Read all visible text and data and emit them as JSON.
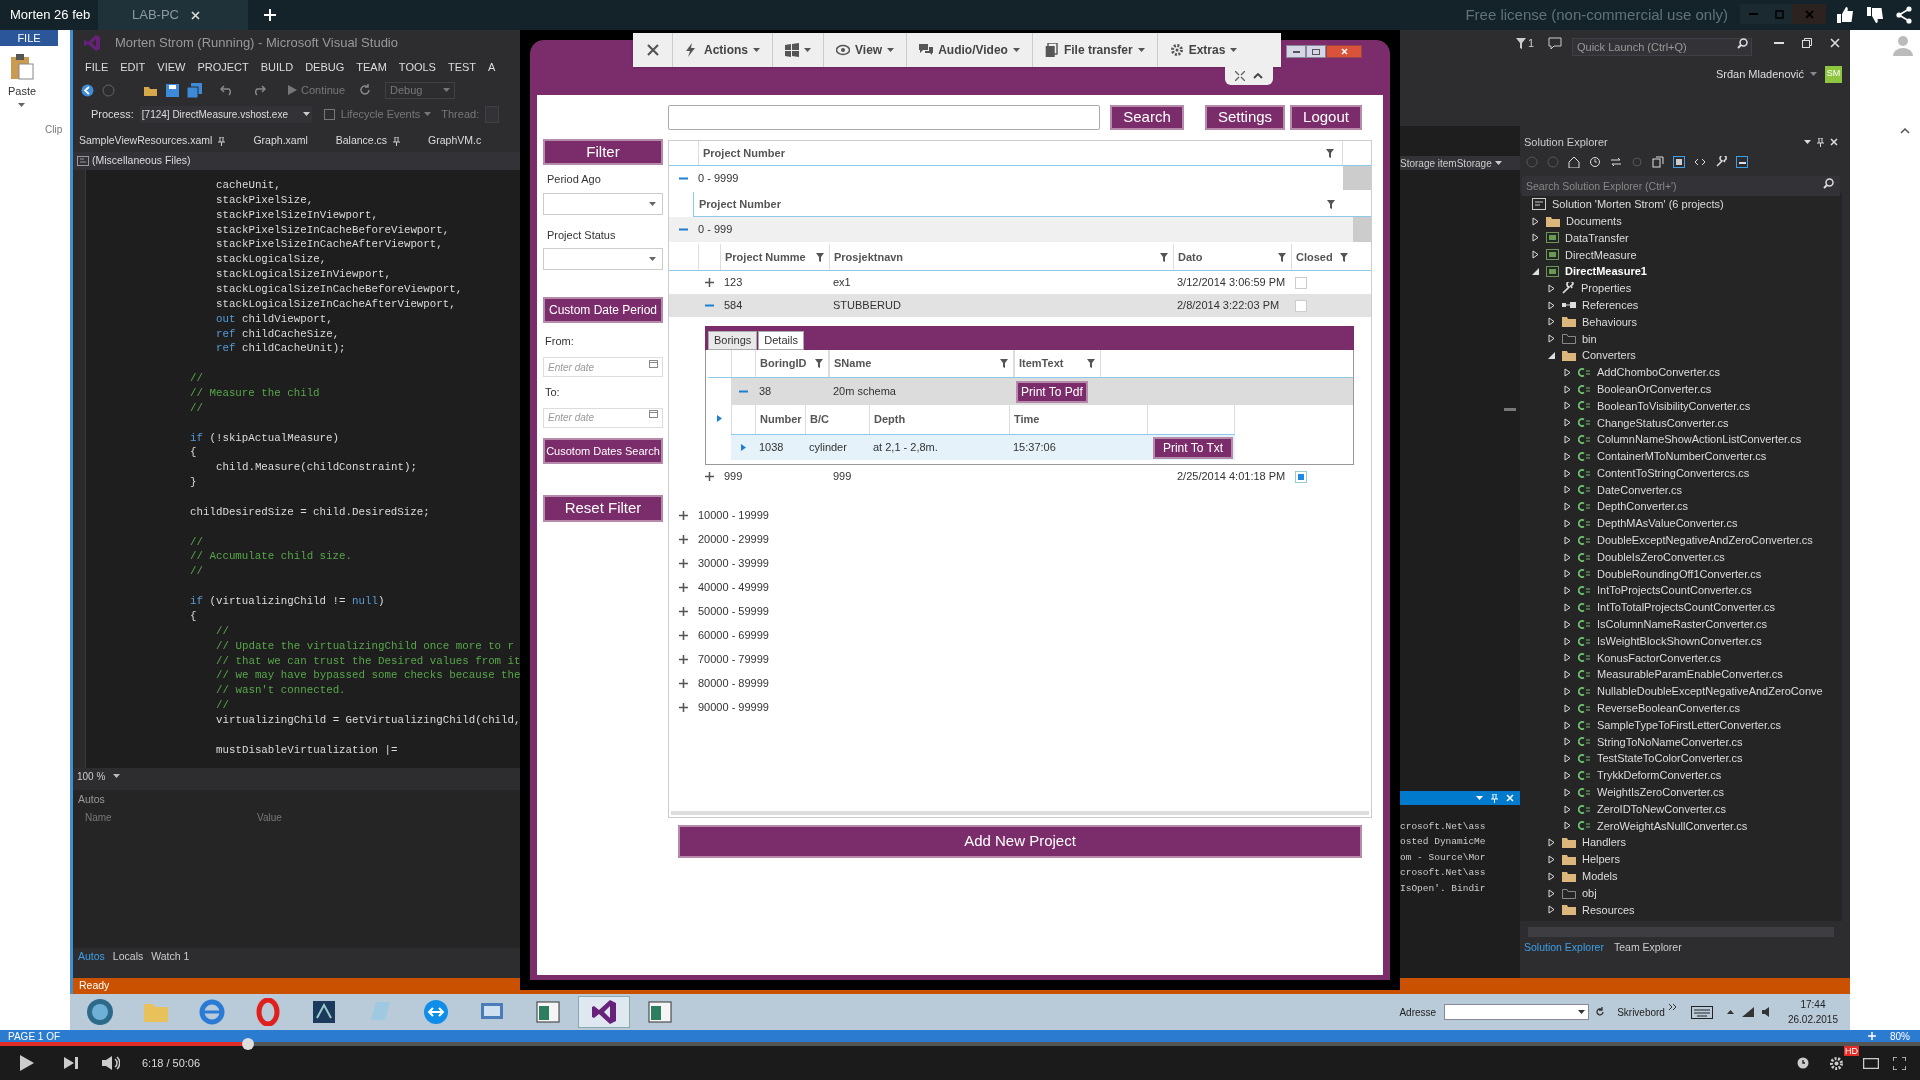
{
  "video_title": "Morten 26 feb",
  "remote_tabs": [
    {
      "label": "LAB-PC",
      "selected": true
    }
  ],
  "license_notice": "Free license (non-commercial use only)",
  "word": {
    "file_tab": "FILE",
    "paste_label": "Paste",
    "group_label": "Clip",
    "page_status": "PAGE 1 OF",
    "zoom": "80%"
  },
  "vs": {
    "title": "Morten Strom (Running) - Microsoft Visual Studio",
    "menu": [
      "FILE",
      "EDIT",
      "VIEW",
      "PROJECT",
      "BUILD",
      "DEBUG",
      "TEAM",
      "TOOLS",
      "TEST",
      "A"
    ],
    "notifications": "1",
    "quick_launch": {
      "placeholder": "Quick Launch (Ctrl+Q)"
    },
    "user": {
      "name": "Srđan Mladenović",
      "initials": "SM"
    },
    "continue": "Continue",
    "config": "Debug",
    "process_label": "Process:",
    "process": "[7124] DirectMeasure.vshost.exe",
    "lifecycle": "Lifecycle Events",
    "thread_label": "Thread:",
    "doc_tabs": [
      {
        "label": "SampleViewResources.xaml",
        "pinned": true
      },
      {
        "label": "Graph.xaml",
        "pinned": false
      },
      {
        "label": "Balance.cs",
        "pinned": true
      },
      {
        "label": "GraphVM.c",
        "pinned": false
      }
    ],
    "nav_scope": "(Miscellaneous Files)",
    "code": [
      {
        "kind": "block",
        "children": [
          {
            "kind": "line",
            "segments": [
              {
                "kind": "plain",
                "text": "cacheUnit,"
              }
            ]
          },
          {
            "kind": "line",
            "segments": [
              {
                "kind": "plain",
                "text": "stackPixelSize,"
              }
            ]
          },
          {
            "kind": "line",
            "segments": [
              {
                "kind": "plain",
                "text": "stackPixelSizeInViewport,"
              }
            ]
          },
          {
            "kind": "line",
            "segments": [
              {
                "kind": "plain",
                "text": "stackPixelSizeInCacheBeforeViewport,"
              }
            ]
          },
          {
            "kind": "line",
            "segments": [
              {
                "kind": "plain",
                "text": "stackPixelSizeInCacheAfterViewport,"
              }
            ]
          },
          {
            "kind": "line",
            "segments": [
              {
                "kind": "plain",
                "text": "stackLogicalSize,"
              }
            ]
          },
          {
            "kind": "line",
            "segments": [
              {
                "kind": "plain",
                "text": "stackLogicalSizeInViewport,"
              }
            ]
          },
          {
            "kind": "line",
            "segments": [
              {
                "kind": "plain",
                "text": "stackLogicalSizeInCacheBeforeViewport,"
              }
            ]
          },
          {
            "kind": "line",
            "segments": [
              {
                "kind": "plain",
                "text": "stackLogicalSizeInCacheAfterViewport,"
              }
            ]
          },
          {
            "kind": "line",
            "segments": [
              {
                "kind": "keyword",
                "text": "out"
              },
              {
                "kind": "plain",
                "text": " childViewport,"
              }
            ]
          },
          {
            "kind": "line",
            "segments": [
              {
                "kind": "keyword",
                "text": "ref"
              },
              {
                "kind": "plain",
                "text": " childCacheSize,"
              }
            ]
          },
          {
            "kind": "line",
            "segments": [
              {
                "kind": "keyword",
                "text": "ref"
              },
              {
                "kind": "plain",
                "text": " childCacheUnit);"
              }
            ]
          }
        ]
      },
      {
        "kind": "blank"
      },
      {
        "kind": "line",
        "segments": [
          {
            "kind": "comment",
            "text": "//"
          }
        ]
      },
      {
        "kind": "line",
        "segments": [
          {
            "kind": "comment",
            "text": "// Measure the child"
          }
        ]
      },
      {
        "kind": "line",
        "segments": [
          {
            "kind": "comment",
            "text": "//"
          }
        ]
      },
      {
        "kind": "blank"
      },
      {
        "kind": "line",
        "segments": [
          {
            "kind": "keyword",
            "text": "if"
          },
          {
            "kind": "plain",
            "text": " (!skipActualMeasure)"
          }
        ]
      },
      {
        "kind": "line",
        "segments": [
          {
            "kind": "plain",
            "text": "{"
          }
        ]
      },
      {
        "kind": "block",
        "children": [
          {
            "kind": "line",
            "segments": [
              {
                "kind": "plain",
                "text": "child.Measure(childConstraint);"
              }
            ]
          }
        ]
      },
      {
        "kind": "line",
        "segments": [
          {
            "kind": "plain",
            "text": "}"
          }
        ]
      },
      {
        "kind": "blank"
      },
      {
        "kind": "line",
        "segments": [
          {
            "kind": "plain",
            "text": "childDesiredSize = child.DesiredSize;"
          }
        ]
      },
      {
        "kind": "blank"
      },
      {
        "kind": "line",
        "segments": [
          {
            "kind": "comment",
            "text": "//"
          }
        ]
      },
      {
        "kind": "line",
        "segments": [
          {
            "kind": "comment",
            "text": "// Accumulate child size."
          }
        ]
      },
      {
        "kind": "line",
        "segments": [
          {
            "kind": "comment",
            "text": "//"
          }
        ]
      },
      {
        "kind": "blank"
      },
      {
        "kind": "line",
        "segments": [
          {
            "kind": "keyword",
            "text": "if"
          },
          {
            "kind": "plain",
            "text": " (virtualizingChild != "
          },
          {
            "kind": "keyword",
            "text": "null"
          },
          {
            "kind": "plain",
            "text": ")"
          }
        ]
      },
      {
        "kind": "line",
        "segments": [
          {
            "kind": "plain",
            "text": "{"
          }
        ]
      },
      {
        "kind": "block",
        "children": [
          {
            "kind": "line",
            "segments": [
              {
                "kind": "comment",
                "text": "//"
              }
            ]
          },
          {
            "kind": "line",
            "segments": [
              {
                "kind": "comment",
                "text": "// Update the virtualizingChild once more to r"
              }
            ]
          },
          {
            "kind": "line",
            "segments": [
              {
                "kind": "comment",
                "text": "// that we can trust the Desired values from it"
              }
            ]
          },
          {
            "kind": "line",
            "segments": [
              {
                "kind": "comment",
                "text": "// we may have bypassed some checks because the"
              }
            ]
          },
          {
            "kind": "line",
            "segments": [
              {
                "kind": "comment",
                "text": "// wasn't connected."
              }
            ]
          },
          {
            "kind": "line",
            "segments": [
              {
                "kind": "comment",
                "text": "//"
              }
            ]
          },
          {
            "kind": "line",
            "segments": [
              {
                "kind": "plain",
                "text": "virtualizingChild = GetVirtualizingChild(child,"
              }
            ]
          },
          {
            "kind": "blank"
          },
          {
            "kind": "line",
            "segments": [
              {
                "kind": "plain",
                "text": "mustDisableVirtualization |="
              }
            ]
          }
        ]
      }
    ],
    "zoom": "100 %",
    "autos": {
      "title": "Autos",
      "columns": [
        "Name",
        "Value"
      ]
    },
    "debug_tabs": [
      {
        "label": "Autos",
        "selected": true
      },
      {
        "label": "Locals",
        "selected": false
      },
      {
        "label": "Watch 1",
        "selected": false
      }
    ],
    "status": "Ready",
    "nav_member": "Storage itemStorage",
    "output_lines": [
      "crosoft.Net\\ass",
      "osted DynamicMe",
      "om - Source\\Mor",
      "crosoft.Net\\ass",
      "IsOpen'. Bindir"
    ],
    "solution_explorer": {
      "title": "Solution Explorer",
      "search": {
        "placeholder": "Search Solution Explorer (Ctrl+')"
      },
      "solution": {
        "label": "Solution 'Morten Strom' (6 projects)",
        "children": [
          {
            "label": "Documents",
            "kind": "folder",
            "expanded": false,
            "startup": false
          },
          {
            "label": "DataTransfer",
            "kind": "project",
            "expanded": false,
            "startup": false
          },
          {
            "label": "DirectMeasure",
            "kind": "project",
            "expanded": false,
            "startup": false
          },
          {
            "label": "DirectMeasure1",
            "kind": "project",
            "expanded": true,
            "startup": true,
            "children": [
              {
                "label": "Properties",
                "kind": "wrench",
                "expanded": false
              },
              {
                "label": "References",
                "kind": "references",
                "expanded": false
              },
              {
                "label": "Behaviours",
                "kind": "folder",
                "expanded": false
              },
              {
                "label": "bin",
                "kind": "folder-outline",
                "expanded": false
              },
              {
                "label": "Converters",
                "kind": "folder",
                "expanded": true,
                "children": [
                  {
                    "label": "AddChomboConverter.cs",
                    "kind": "cs",
                    "expanded": false
                  },
                  {
                    "label": "BooleanOrConverter.cs",
                    "kind": "cs",
                    "expanded": false
                  },
                  {
                    "label": "BooleanToVisibilityConverter.cs",
                    "kind": "cs",
                    "expanded": false
                  },
                  {
                    "label": "ChangeStatusConverter.cs",
                    "kind": "cs",
                    "expanded": false
                  },
                  {
                    "label": "ColumnNameShowActionListConverter.cs",
                    "kind": "cs",
                    "expanded": false
                  },
                  {
                    "label": "ContainerMToNumberConverter.cs",
                    "kind": "cs",
                    "expanded": false
                  },
                  {
                    "label": "ContentToStringConvertercs.cs",
                    "kind": "cs",
                    "expanded": false
                  },
                  {
                    "label": "DateConverter.cs",
                    "kind": "cs",
                    "expanded": false
                  },
                  {
                    "label": "DepthConverter.cs",
                    "kind": "cs",
                    "expanded": false
                  },
                  {
                    "label": "DepthMAsValueConverter.cs",
                    "kind": "cs",
                    "expanded": false
                  },
                  {
                    "label": "DoubleExceptNegativeAndZeroConverter.cs",
                    "kind": "cs",
                    "expanded": false
                  },
                  {
                    "label": "DoubleIsZeroConverter.cs",
                    "kind": "cs",
                    "expanded": false
                  },
                  {
                    "label": "DoubleRoundingOff1Converter.cs",
                    "kind": "cs",
                    "expanded": false
                  },
                  {
                    "label": "IntToProjectsCountConverter.cs",
                    "kind": "cs",
                    "expanded": false
                  },
                  {
                    "label": "IntToTotalProjectsCountConverter.cs",
                    "kind": "cs",
                    "expanded": false
                  },
                  {
                    "label": "IsColumnNameRasterConverter.cs",
                    "kind": "cs",
                    "expanded": false
                  },
                  {
                    "label": "IsWeightBlockShownConverter.cs",
                    "kind": "cs",
                    "expanded": false
                  },
                  {
                    "label": "KonusFactorConverter.cs",
                    "kind": "cs",
                    "expanded": false
                  },
                  {
                    "label": "MeasurableParamEnableConverter.cs",
                    "kind": "cs",
                    "expanded": false
                  },
                  {
                    "label": "NullableDoubleExceptNegativeAndZeroConve",
                    "kind": "cs",
                    "expanded": false
                  },
                  {
                    "label": "ReverseBooleanConverter.cs",
                    "kind": "cs",
                    "expanded": false
                  },
                  {
                    "label": "SampleTypeToFirstLetterConverter.cs",
                    "kind": "cs",
                    "expanded": false
                  },
                  {
                    "label": "StringToNoNameConverter.cs",
                    "kind": "cs",
                    "expanded": false
                  },
                  {
                    "label": "TestStateToColorConverter.cs",
                    "kind": "cs",
                    "expanded": false
                  },
                  {
                    "label": "TrykkDeformConverter.cs",
                    "kind": "cs",
                    "expanded": false
                  },
                  {
                    "label": "WeightIsZeroConverter.cs",
                    "kind": "cs",
                    "expanded": false
                  },
                  {
                    "label": "ZeroIDToNewConverter.cs",
                    "kind": "cs",
                    "expanded": false
                  },
                  {
                    "label": "ZeroWeightAsNullConverter.cs",
                    "kind": "cs",
                    "expanded": false
                  }
                ]
              },
              {
                "label": "Handlers",
                "kind": "folder",
                "expanded": false
              },
              {
                "label": "Helpers",
                "kind": "folder",
                "expanded": false
              },
              {
                "label": "Models",
                "kind": "folder",
                "expanded": false
              },
              {
                "label": "obj",
                "kind": "folder-outline",
                "expanded": false
              },
              {
                "label": "Resources",
                "kind": "folder",
                "expanded": false
              }
            ]
          }
        ]
      }
    },
    "explorer_tabs": [
      {
        "label": "Solution Explorer",
        "selected": true
      },
      {
        "label": "Team Explorer",
        "selected": false
      }
    ]
  },
  "remote_toolbar": {
    "items": [
      {
        "kind": "actions",
        "label": "Actions"
      },
      {
        "kind": "windows"
      },
      {
        "kind": "view",
        "label": "View"
      },
      {
        "kind": "audio",
        "label": "Audio/Video"
      },
      {
        "kind": "files",
        "label": "File transfer"
      },
      {
        "kind": "extras",
        "label": "Extras"
      }
    ]
  },
  "app": {
    "buttons": [
      "Search",
      "Settings",
      "Logout"
    ],
    "filter": {
      "title": "Filter",
      "selects": [
        "Period Ago",
        "Project Status"
      ],
      "custom_button": "Custom Date Period",
      "from_label": "From:",
      "from_placeholder": "Enter date",
      "to_label": "To:",
      "to_placeholder": "Enter date",
      "search_button": "Cusotom Dates Search",
      "reset_button": "Reset Filter"
    },
    "grid": {
      "group_header": "Project Number",
      "group": {
        "label": "0 - 9999",
        "expanded": true
      },
      "sub_header": "Project Number",
      "subgroup": {
        "label": "0 - 999",
        "expanded": true
      },
      "columns": [
        "Project Numme",
        "Prosjektnavn",
        "Dato",
        "Closed"
      ],
      "rows": [
        {
          "number": "123",
          "name": "ex1",
          "date": "3/12/2014 3:06:59 PM",
          "closed": false,
          "expanded": false,
          "selected": false
        },
        {
          "number": "584",
          "name": "STUBBERUD",
          "date": "2/8/2014 3:22:03 PM",
          "closed": false,
          "expanded": true,
          "selected": true
        },
        {
          "number": "999",
          "name": "999",
          "date": "2/25/2014 4:01:18 PM",
          "closed": true,
          "expanded": false,
          "selected": false
        }
      ],
      "details": {
        "tabs": [
          {
            "label": "Borings",
            "selected": true
          },
          {
            "label": "Details",
            "selected": false
          }
        ],
        "columns": [
          "BoringID",
          "SName",
          "ItemText"
        ],
        "row": {
          "id": "38",
          "name": "20m schema",
          "button": "Print To Pdf",
          "expanded": true
        },
        "sub_columns": [
          "Number",
          "B/C",
          "Depth",
          "Time"
        ],
        "sub_row": {
          "number": "1038",
          "bc": "cylinder",
          "depth": "at 2,1 - 2,8m.",
          "time": "15:37:06",
          "button": "Print To Txt"
        }
      },
      "other_groups": [
        "10000 - 19999",
        "20000 - 29999",
        "30000 - 39999",
        "40000 - 49999",
        "50000 - 59999",
        "60000 - 69999",
        "70000 - 79999",
        "80000 - 89999",
        "90000 - 99999"
      ]
    },
    "add_button": "Add New Project"
  },
  "taskbar": {
    "address_label": "Adresse",
    "toolbar_label": "Skrivebord",
    "time": "17:44",
    "date": "26.02.2015"
  },
  "player": {
    "level": 0.129,
    "time": "6:18 / 50:06",
    "hd_badge": "HD"
  }
}
